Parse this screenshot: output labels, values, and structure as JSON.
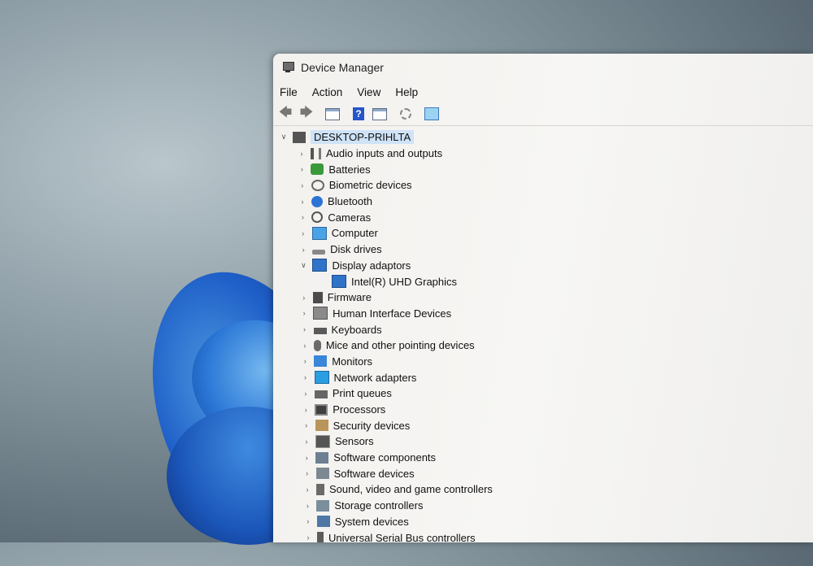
{
  "window": {
    "title": "Device Manager"
  },
  "menu": [
    "File",
    "Action",
    "View",
    "Help"
  ],
  "toolbar": {
    "buttons": [
      "back-arrow",
      "forward-arrow",
      "properties",
      "help",
      "update-driver",
      "scan-hardware",
      "monitor"
    ]
  },
  "tree": {
    "root": "DESKTOP-PRIHLTA",
    "categories": [
      {
        "label": "Audio inputs and outputs",
        "icon": "speaker-icon",
        "expanded": false
      },
      {
        "label": "Batteries",
        "icon": "battery-icon",
        "expanded": false
      },
      {
        "label": "Biometric devices",
        "icon": "fingerprint-icon",
        "expanded": false
      },
      {
        "label": "Bluetooth",
        "icon": "bluetooth-icon",
        "expanded": false
      },
      {
        "label": "Cameras",
        "icon": "camera-icon",
        "expanded": false
      },
      {
        "label": "Computer",
        "icon": "computer-icon",
        "expanded": false
      },
      {
        "label": "Disk drives",
        "icon": "disk-icon",
        "expanded": false
      },
      {
        "label": "Display adaptors",
        "icon": "display-adapter-icon",
        "expanded": true,
        "children": [
          "Intel(R) UHD Graphics"
        ]
      },
      {
        "label": "Firmware",
        "icon": "firmware-icon",
        "expanded": false
      },
      {
        "label": "Human Interface Devices",
        "icon": "hid-icon",
        "expanded": false
      },
      {
        "label": "Keyboards",
        "icon": "keyboard-icon",
        "expanded": false
      },
      {
        "label": "Mice and other pointing devices",
        "icon": "mouse-icon",
        "expanded": false
      },
      {
        "label": "Monitors",
        "icon": "monitor-icon",
        "expanded": false
      },
      {
        "label": "Network adapters",
        "icon": "network-icon",
        "expanded": false
      },
      {
        "label": "Print queues",
        "icon": "printer-icon",
        "expanded": false
      },
      {
        "label": "Processors",
        "icon": "processor-icon",
        "expanded": false
      },
      {
        "label": "Security devices",
        "icon": "security-icon",
        "expanded": false
      },
      {
        "label": "Sensors",
        "icon": "sensor-icon",
        "expanded": false
      },
      {
        "label": "Software components",
        "icon": "software-component-icon",
        "expanded": false
      },
      {
        "label": "Software devices",
        "icon": "software-device-icon",
        "expanded": false
      },
      {
        "label": "Sound, video and game controllers",
        "icon": "sound-icon",
        "expanded": false
      },
      {
        "label": "Storage controllers",
        "icon": "storage-icon",
        "expanded": false
      },
      {
        "label": "System devices",
        "icon": "system-icon",
        "expanded": false
      },
      {
        "label": "Universal Serial Bus controllers",
        "icon": "usb-icon",
        "expanded": false
      }
    ]
  }
}
